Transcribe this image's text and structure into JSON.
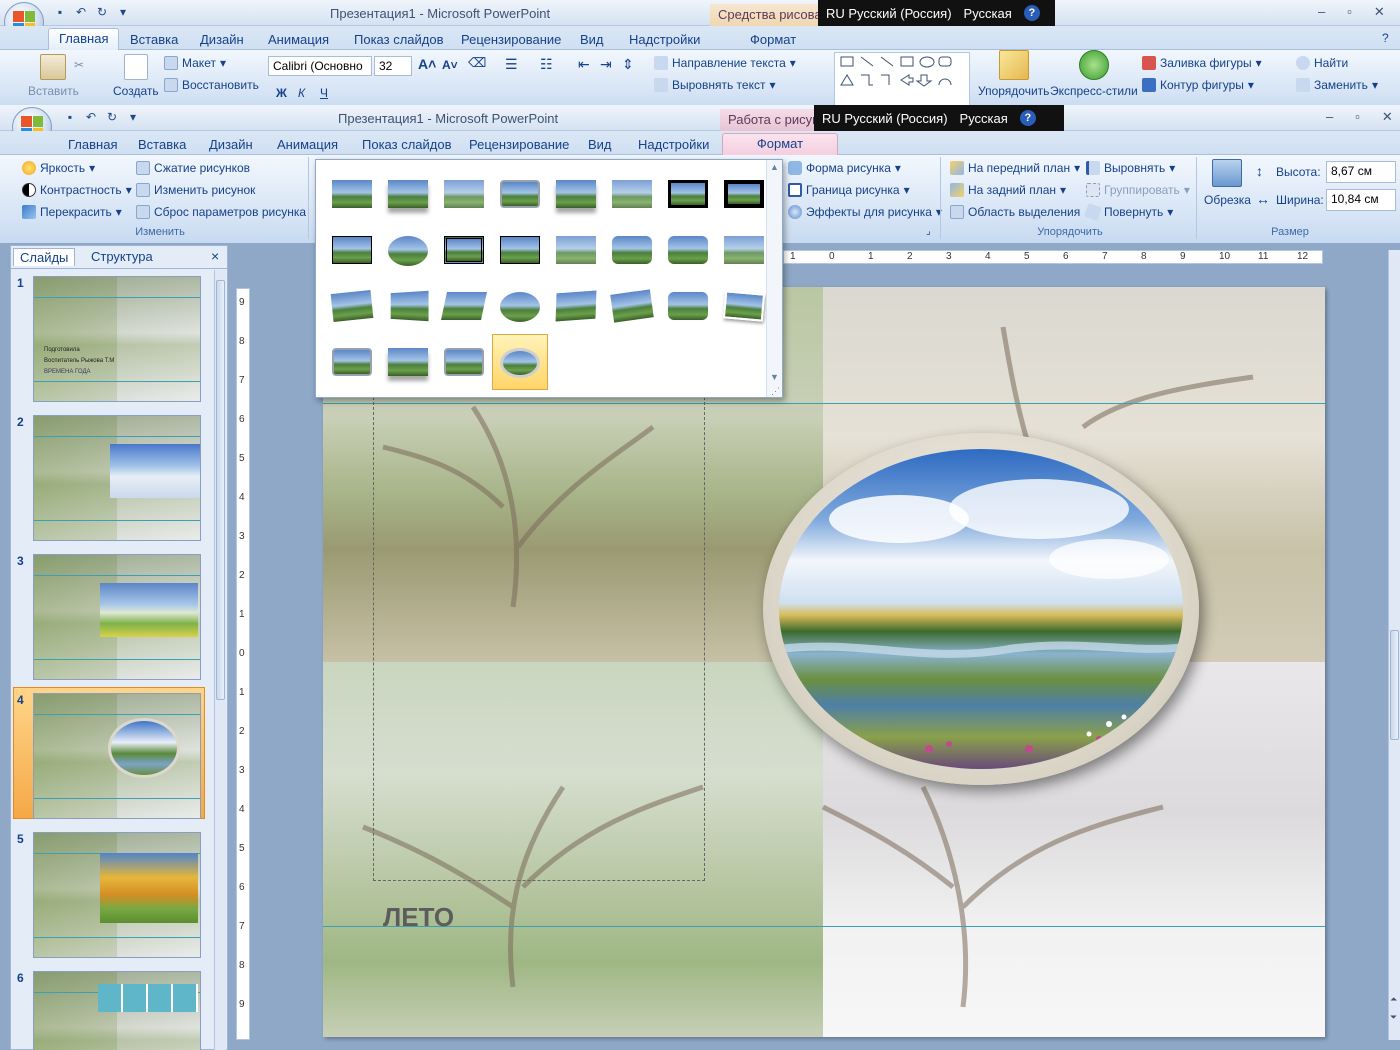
{
  "back_window": {
    "title": "Презентация1 - Microsoft PowerPoint",
    "context_tag": "Средства рисова",
    "language": {
      "indicator": "RU Русский (Россия)",
      "keyboard": "Русская",
      "help": "?"
    },
    "tabs": [
      "Главная",
      "Вставка",
      "Дизайн",
      "Анимация",
      "Показ слайдов",
      "Рецензирование",
      "Вид",
      "Надстройки",
      "Формат"
    ],
    "active_tab": "Главная",
    "ribbon": {
      "paste": "Вставить",
      "create": "Создать",
      "layout": "Макет",
      "restore": "Восстановить",
      "font_name": "Calibri (Основно",
      "font_size": "32",
      "text_direction": "Направление текста",
      "align_text": "Выровнять текст",
      "arrange": "Упорядочить",
      "quick_styles": "Экспресс-стили",
      "shape_fill": "Заливка фигуры",
      "shape_outline": "Контур фигуры",
      "find": "Найти",
      "replace": "Заменить"
    }
  },
  "front_window": {
    "title": "Презентация1 - Microsoft PowerPoint",
    "context_tag": "Работа с рисунк",
    "language": {
      "indicator": "RU Русский (Россия)",
      "keyboard": "Русская",
      "help": "?"
    },
    "tabs": [
      "Главная",
      "Вставка",
      "Дизайн",
      "Анимация",
      "Показ слайдов",
      "Рецензирование",
      "Вид",
      "Надстройки",
      "Формат"
    ],
    "active_tab": "Формат",
    "ribbon": {
      "brightness": "Яркость",
      "contrast": "Контрастность",
      "recolor": "Перекрасить",
      "compress": "Сжатие рисунков",
      "change_picture": "Изменить рисунок",
      "reset_picture": "Сброс параметров рисунка",
      "group_adjust": "Изменить",
      "picture_shape": "Форма рисунка",
      "picture_border": "Граница рисунка",
      "picture_effects": "Эффекты для рисунка",
      "bring_front": "На передний план",
      "send_back": "На задний план",
      "selection_pane": "Область выделения",
      "align": "Выровнять",
      "group": "Группировать",
      "rotate": "Повернуть",
      "group_arrange": "Упорядочить",
      "crop": "Обрезка",
      "height_label": "Высота:",
      "height_value": "8,67 см",
      "width_label": "Ширина:",
      "width_value": "10,84 см",
      "group_size": "Размер"
    }
  },
  "slide_pane": {
    "tabs": [
      "Слайды",
      "Структура"
    ],
    "active_tab": "Слайды",
    "close": "×",
    "slides": [
      {
        "number": "1",
        "text_lines": [
          "Подготовила",
          "Воспитатель Рыжова Т.М",
          "ВРЕМЕНА  ГОДА"
        ]
      },
      {
        "number": "2",
        "picture": "winter"
      },
      {
        "number": "3",
        "picture": "spring"
      },
      {
        "number": "4",
        "picture": "summer-oval",
        "selected": true
      },
      {
        "number": "5",
        "picture": "autumn"
      },
      {
        "number": "6",
        "picture": "table"
      }
    ]
  },
  "slide": {
    "caption": "ЛЕТО"
  },
  "ruler": {
    "h_ticks": [
      "1",
      "0",
      "1",
      "2",
      "3",
      "4",
      "5",
      "6",
      "7",
      "8",
      "9",
      "10",
      "11",
      "12"
    ],
    "v_ticks": [
      "9",
      "8",
      "7",
      "6",
      "5",
      "4",
      "3",
      "2",
      "1",
      "0",
      "1",
      "2",
      "3",
      "4",
      "5",
      "6",
      "7",
      "8",
      "9"
    ]
  },
  "colors": {
    "ribbon_accent": "#15428b",
    "selection_orange": "#f5a847",
    "guide_teal": "#3ba0b4",
    "context_pink": "#e7c3d3"
  }
}
